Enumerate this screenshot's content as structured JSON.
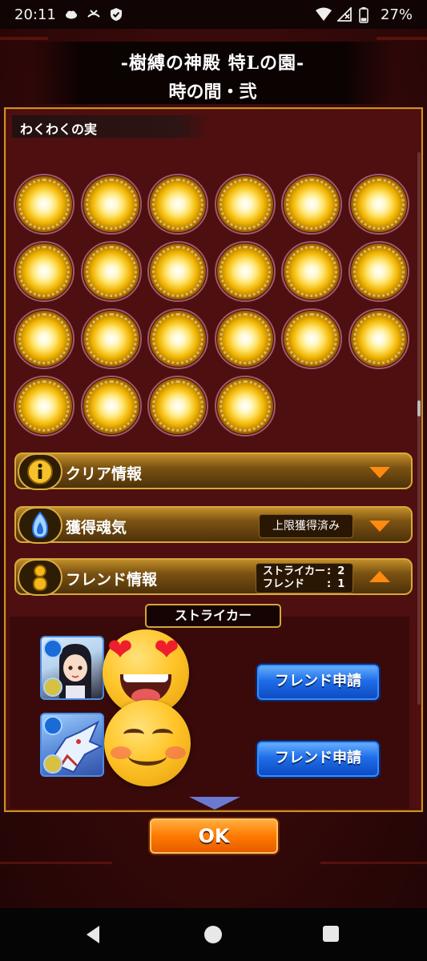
{
  "status_bar": {
    "time": "20:11",
    "battery": "27%",
    "icons": [
      "cloud-icon",
      "missed-call-icon",
      "shield-icon",
      "wifi-icon",
      "no-signal-icon",
      "battery-icon"
    ]
  },
  "header": {
    "title_line1": "-樹縛の神殿 特Lの園-",
    "title_line2": "時の間・弐"
  },
  "fruit_section": {
    "label": "わくわくの実",
    "count": 22
  },
  "sections": {
    "clear_info": {
      "label": "クリア情報",
      "icon": "info-icon",
      "state": "collapsed"
    },
    "soul_gain": {
      "label": "獲得魂気",
      "status": "上限獲得済み",
      "icon": "soul-flame-icon",
      "state": "collapsed"
    },
    "friend_info": {
      "label": "フレンド情報",
      "icon": "friend-icon",
      "state": "expanded",
      "striker_label": "ストライカー",
      "striker_value": "2",
      "friend_label": "フレンド",
      "friend_value": "1",
      "separator": ":"
    }
  },
  "friend_panel": {
    "tab_label": "ストライカー",
    "entries": [
      {
        "avatar": "girl-character-avatar",
        "emoji": "heart-eyes-emoji",
        "button_label": "フレンド申請"
      },
      {
        "avatar": "dragon-character-avatar",
        "emoji": "smiling-emoji",
        "button_label": "フレンド申請"
      }
    ]
  },
  "ok_button": {
    "label": "OK"
  },
  "colors": {
    "panel_border": "#c8961f",
    "accent_orange": "#ff8a10",
    "friend_button_blue": "#1f6ee8",
    "ok_orange": "#ff7a00"
  }
}
